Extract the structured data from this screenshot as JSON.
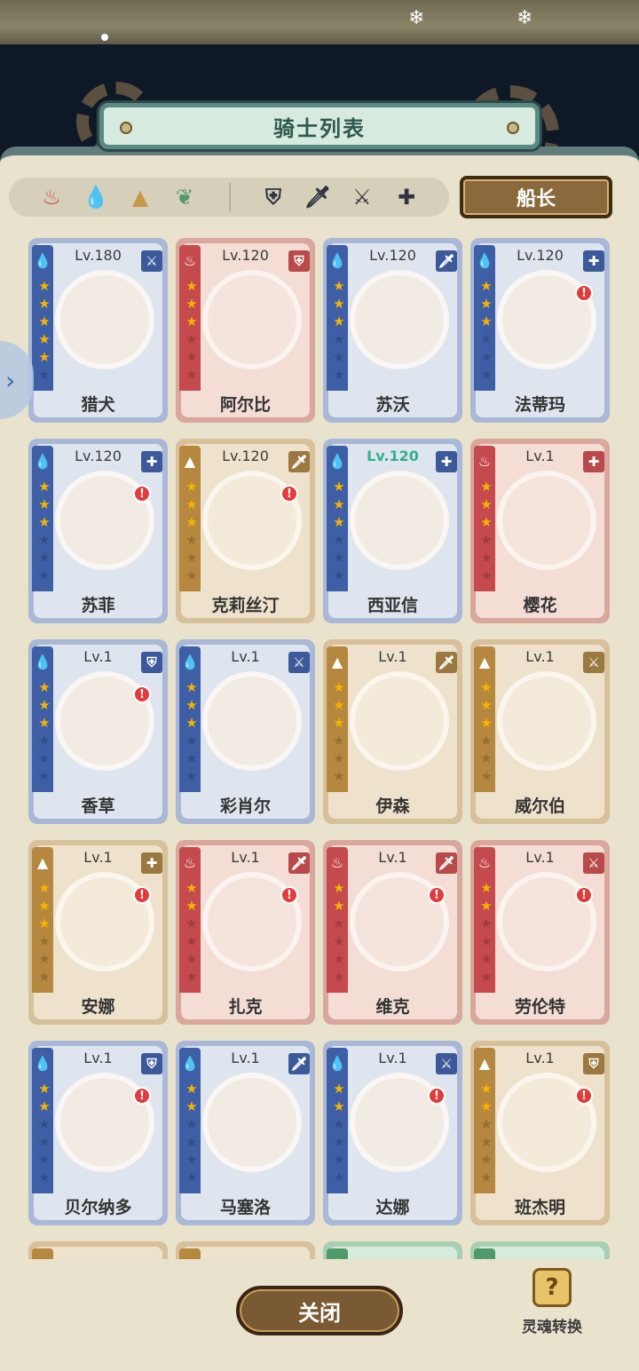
{
  "window": {
    "title": "骑士列表"
  },
  "filters": {
    "elements": [
      {
        "icon": "fire-element-icon",
        "glyph": "♨",
        "color": "#c44a4e"
      },
      {
        "icon": "water-element-icon",
        "glyph": "💧",
        "color": "#3e7fd0"
      },
      {
        "icon": "earth-element-icon",
        "glyph": "▲",
        "color": "#c79a4b"
      },
      {
        "icon": "wind-element-icon",
        "glyph": "❦",
        "color": "#4f9a6a"
      }
    ],
    "classes": [
      {
        "icon": "shield-class-icon",
        "glyph": "⛨",
        "color": "#2f3440"
      },
      {
        "icon": "sword-class-icon",
        "glyph": "🗡",
        "color": "#2f3440"
      },
      {
        "icon": "crossed-weapons-class-icon",
        "glyph": "⚔",
        "color": "#2f3440"
      },
      {
        "icon": "healer-cross-class-icon",
        "glyph": "✚",
        "color": "#2f3440"
      }
    ],
    "captain_label": "船长"
  },
  "knights": [
    {
      "level": "Lv.180",
      "name": "猎犬",
      "element": "water",
      "stars": 5,
      "cls": "crossbow",
      "alert": false
    },
    {
      "level": "Lv.120",
      "name": "阿尔比",
      "element": "fire",
      "stars": 3,
      "cls": "shield",
      "alert": false
    },
    {
      "level": "Lv.120",
      "name": "苏沃",
      "element": "water",
      "stars": 3,
      "cls": "sword",
      "alert": false
    },
    {
      "level": "Lv.120",
      "name": "法蒂玛",
      "element": "water",
      "stars": 3,
      "cls": "heal",
      "alert": true
    },
    {
      "level": "Lv.120",
      "name": "苏菲",
      "element": "water",
      "stars": 3,
      "cls": "heal",
      "alert": true
    },
    {
      "level": "Lv.120",
      "name": "克莉丝汀",
      "element": "earth",
      "stars": 3,
      "cls": "sword",
      "alert": true
    },
    {
      "level": "Lv.120",
      "name": "西亚信",
      "element": "water",
      "stars": 3,
      "cls": "heal",
      "alert": false,
      "green": true
    },
    {
      "level": "Lv.1",
      "name": "樱花",
      "element": "fire",
      "stars": 3,
      "cls": "heal",
      "alert": false
    },
    {
      "level": "Lv.1",
      "name": "香草",
      "element": "water",
      "stars": 3,
      "cls": "shield",
      "alert": true
    },
    {
      "level": "Lv.1",
      "name": "彩肖尔",
      "element": "water",
      "stars": 3,
      "cls": "crossbow",
      "alert": false
    },
    {
      "level": "Lv.1",
      "name": "伊森",
      "element": "earth",
      "stars": 3,
      "cls": "sword",
      "alert": false
    },
    {
      "level": "Lv.1",
      "name": "威尔伯",
      "element": "earth",
      "stars": 3,
      "cls": "crossbow",
      "alert": false
    },
    {
      "level": "Lv.1",
      "name": "安娜",
      "element": "earth",
      "stars": 3,
      "cls": "heal",
      "alert": true
    },
    {
      "level": "Lv.1",
      "name": "扎克",
      "element": "fire",
      "stars": 2,
      "cls": "sword",
      "alert": true
    },
    {
      "level": "Lv.1",
      "name": "维克",
      "element": "fire",
      "stars": 2,
      "cls": "sword",
      "alert": true
    },
    {
      "level": "Lv.1",
      "name": "劳伦特",
      "element": "fire",
      "stars": 2,
      "cls": "crossbow",
      "alert": true
    },
    {
      "level": "Lv.1",
      "name": "贝尔纳多",
      "element": "water",
      "stars": 2,
      "cls": "shield",
      "alert": true
    },
    {
      "level": "Lv.1",
      "name": "马塞洛",
      "element": "water",
      "stars": 2,
      "cls": "sword",
      "alert": false
    },
    {
      "level": "Lv.1",
      "name": "达娜",
      "element": "water",
      "stars": 2,
      "cls": "crossbow",
      "alert": true
    },
    {
      "level": "Lv.1",
      "name": "班杰明",
      "element": "earth",
      "stars": 2,
      "cls": "shield",
      "alert": true
    },
    {
      "level": "",
      "name": "",
      "element": "earth",
      "stars": 0,
      "cls": "",
      "alert": false
    },
    {
      "level": "",
      "name": "",
      "element": "earth",
      "stars": 0,
      "cls": "",
      "alert": false
    },
    {
      "level": "",
      "name": "",
      "element": "wind",
      "stars": 0,
      "cls": "",
      "alert": false
    },
    {
      "level": "",
      "name": "",
      "element": "wind",
      "stars": 0,
      "cls": "",
      "alert": false
    }
  ],
  "icons": {
    "element_glyph": {
      "water": "💧",
      "fire": "♨",
      "earth": "▲",
      "wind": "❦"
    },
    "element_color": {
      "water": "#3e7fd0",
      "fire": "#c44a4e",
      "earth": "#b6873f",
      "wind": "#4f9a6a"
    },
    "class_glyph": {
      "shield": "⛨",
      "sword": "🗡",
      "crossbow": "⚔",
      "heal": "✚"
    },
    "alert_glyph": "!",
    "star_glyph": "★"
  },
  "footer": {
    "close_label": "关闭",
    "soul_label": "灵魂转换",
    "soul_icon_glyph": "?"
  },
  "side": {
    "arrow_glyph": "›"
  },
  "decor": {
    "snow_glyph": "❄"
  }
}
